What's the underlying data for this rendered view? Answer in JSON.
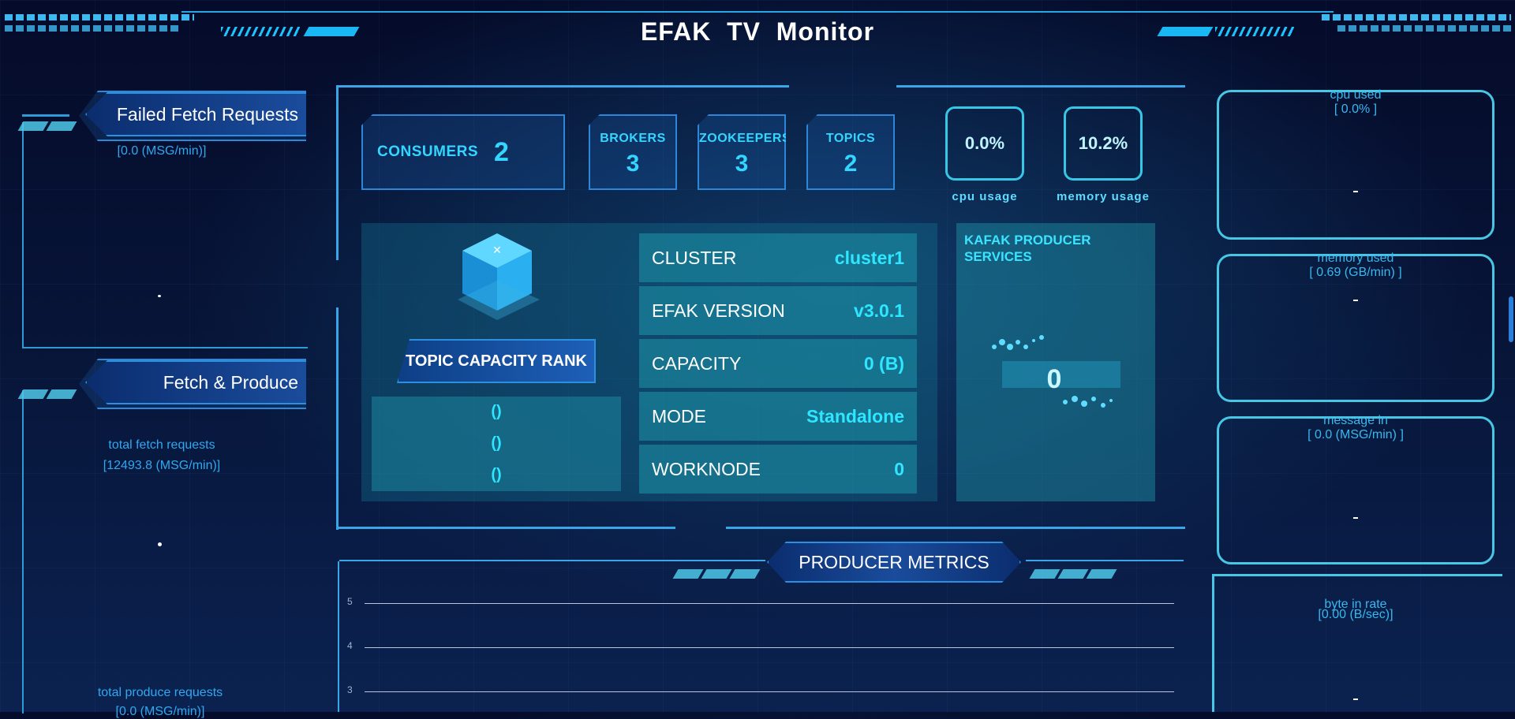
{
  "header": {
    "title": "EFAK  TV  Monitor"
  },
  "left": {
    "failed_fetch": {
      "title": "Failed Fetch Requests",
      "value": "[0.0 (MSG/min)]"
    },
    "fetch_produce": {
      "title": "Fetch & Produce",
      "fetch_label": "total fetch requests",
      "fetch_value": "[12493.8 (MSG/min)]",
      "produce_label": "total produce requests",
      "produce_value": "[0.0 (MSG/min)]"
    }
  },
  "stats": {
    "consumers": {
      "label": "CONSUMERS",
      "value": "2"
    },
    "brokers": {
      "label": "BROKERS",
      "value": "3"
    },
    "zookeepers": {
      "label": "ZOOKEEPERS",
      "value": "3"
    },
    "topics": {
      "label": "TOPICS",
      "value": "2"
    },
    "cpu": {
      "value": "0.0%",
      "label": "cpu usage"
    },
    "memory": {
      "value": "10.2%",
      "label": "memory usage"
    }
  },
  "topic_rank": {
    "title": "TOPIC CAPACITY RANK",
    "items": [
      "()",
      "()",
      "()"
    ]
  },
  "cluster_info": {
    "rows": [
      {
        "key": "CLUSTER",
        "value": "cluster1"
      },
      {
        "key": "EFAK VERSION",
        "value": "v3.0.1"
      },
      {
        "key": "CAPACITY",
        "value": "0 (B)"
      },
      {
        "key": "MODE",
        "value": "Standalone"
      },
      {
        "key": "WORKNODE",
        "value": "0"
      }
    ]
  },
  "producer_services": {
    "title": "KAFAK PRODUCER SERVICES",
    "value": "0"
  },
  "producer_metrics": {
    "title": "PRODUCER METRICS",
    "y_ticks": [
      "5",
      "4",
      "3"
    ]
  },
  "right": {
    "cpu_used": {
      "label": "cpu used",
      "value": "[ 0.0% ]"
    },
    "memory_used": {
      "label": "memory used",
      "value": "[ 0.69 (GB/min) ]"
    },
    "message_in": {
      "label": "message in",
      "value": "[ 0.0 (MSG/min) ]"
    },
    "byte_in_rate": {
      "label": "byte in rate",
      "value": "[0.00 (B/sec)]"
    }
  },
  "colors": {
    "accent": "#33d6ff",
    "frame": "#2e9bd6",
    "panel": "#1e96aa"
  }
}
